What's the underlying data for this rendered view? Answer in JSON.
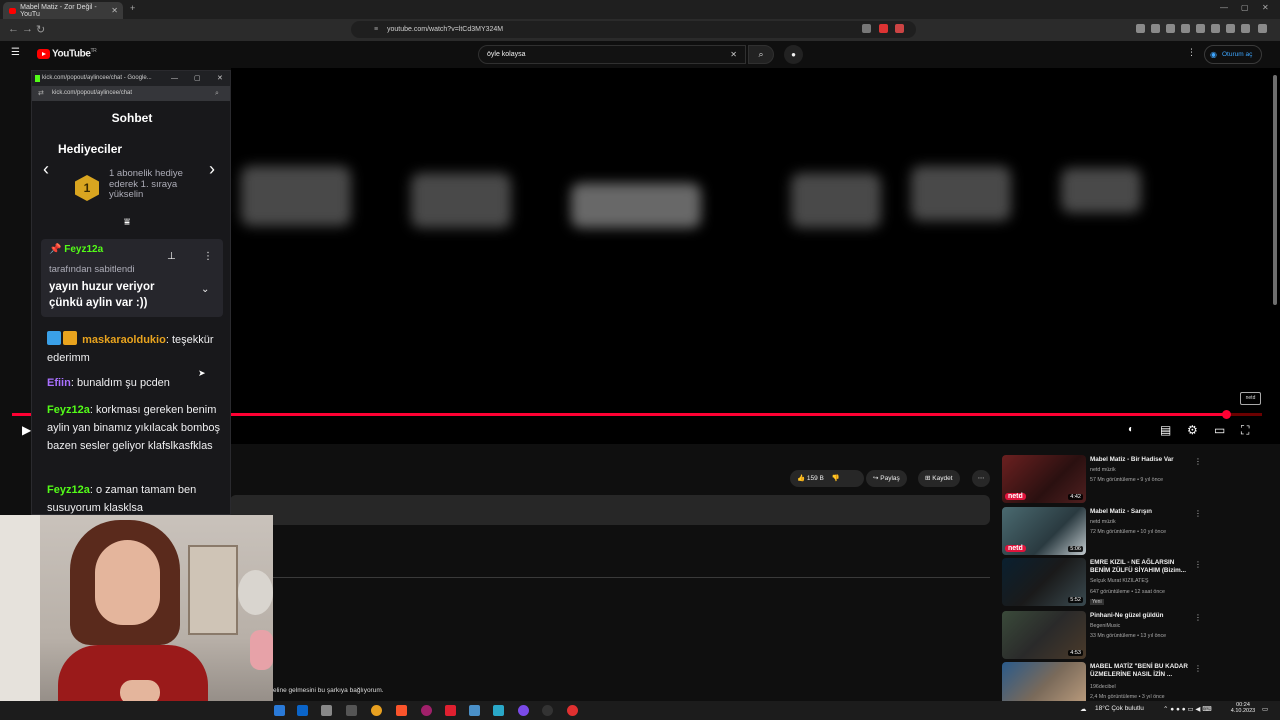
{
  "browser": {
    "tab_title": "Mabel Matiz - Zor Değil - YouTu",
    "url": "youtube.com/watch?v=ltCd3MY324M"
  },
  "youtube": {
    "logo_text": "YouTube",
    "logo_sup": "TR",
    "search_value": "öyle kolaysa",
    "signin_label": "Oturum aç"
  },
  "actions": {
    "like_count": "159 B",
    "share_label": "Paylaş",
    "save_label": "Kaydet"
  },
  "caption_text": "eline gelmesini bu şarkıya bağlıyorum.",
  "watermark": "netd",
  "chat": {
    "window_title": "kick.com/popout/aylincee/chat - Google...",
    "url": "kick.com/popout/aylincee/chat",
    "title": "Sohbet",
    "gifters_title": "Hediyeciler",
    "gift_number": "1",
    "gift_text": "1 abonelik hediye ederek 1. sıraya yükselin",
    "pinned": {
      "user": "Feyz12a",
      "pinned_by": "tarafından sabitlendi",
      "message": "yayın huzur veriyor çünkü aylin var :))"
    },
    "messages": [
      {
        "user": "maskaraoldukio",
        "text": "teşekkür ederimm",
        "color": "#e8a31e"
      },
      {
        "user": "Efiin",
        "text": "bunaldım şu pcden",
        "color": "#a970ff"
      },
      {
        "user": "Feyz12a",
        "text": "korkması gereken benim aylin yan binamız yıkılacak bomboş bazen sesler geliyor klafslkasfklas",
        "color": "#53fc18"
      },
      {
        "user": "Feyz12a",
        "text": "o zaman tamam ben susuyorum klasklsa",
        "color": "#53fc18"
      }
    ]
  },
  "recommendations": [
    {
      "title": "Mabel Matiz - Bir Hadise Var",
      "channel": "netd müzik",
      "meta": "57 Mn görüntüleme • 9 yıl önce",
      "duration": "4:42",
      "netd": "netd"
    },
    {
      "title": "Mabel Matiz - Sarışın",
      "channel": "netd müzik",
      "meta": "72 Mn görüntüleme • 10 yıl önce",
      "duration": "5:06",
      "netd": "netd"
    },
    {
      "title": "EMRE KIZIL - NE AĞLARSIN BENİM ZÜLFÜ SİYAHIM (Bizim...",
      "channel": "Selçuk Murat KIZILATEŞ",
      "meta": "647 görüntüleme • 12 saat önce",
      "duration": "5:52",
      "badge": "Yeni"
    },
    {
      "title": "Pinhani-Ne güzel güldün",
      "channel": "BegeniMusic",
      "meta": "33 Mn görüntüleme • 13 yıl önce",
      "duration": "4:53"
    },
    {
      "title": "MABEL MATİZ \"BENİ BU KADAR ÜZMELERİNE NASIL İZİN ...",
      "channel": "196decibel",
      "meta": "2,4 Mn görüntüleme • 3 yıl önce",
      "duration": ""
    }
  ],
  "taskbar": {
    "weather": "18°C  Çok bulutlu",
    "time": "00:24",
    "date": "4.10.2023"
  }
}
